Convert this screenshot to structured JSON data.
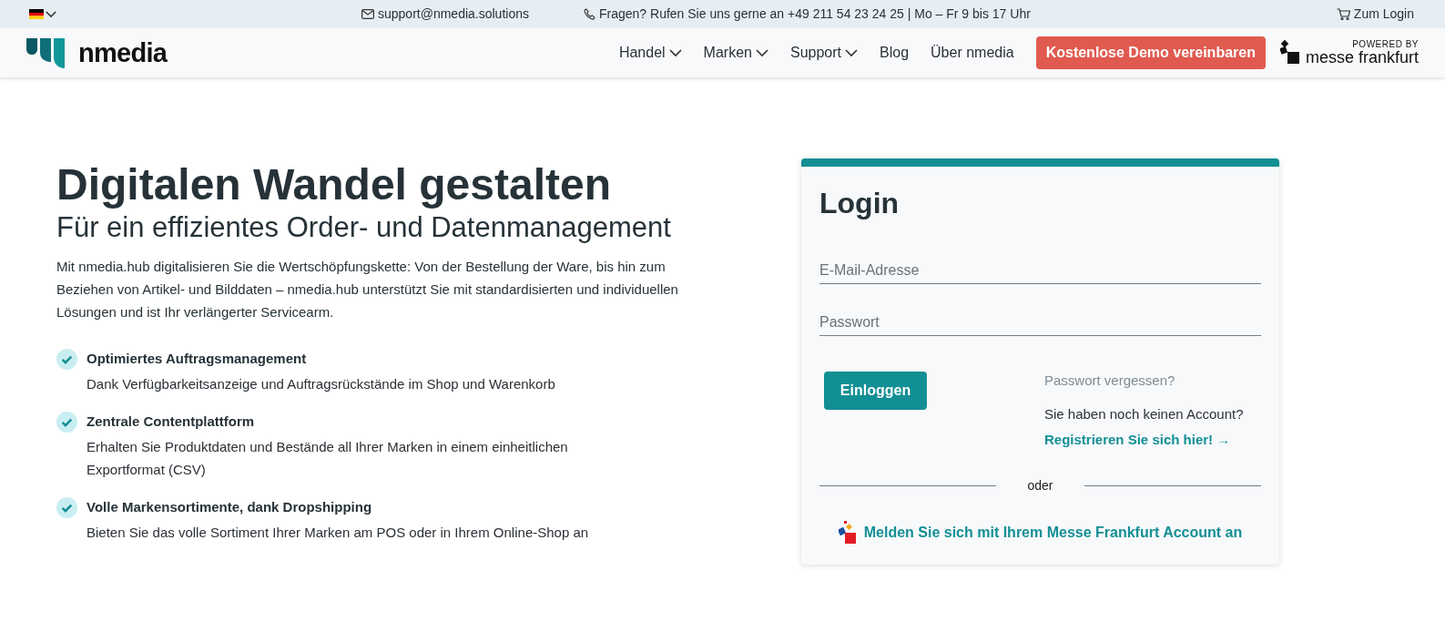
{
  "top_bar": {
    "language_menu": {
      "expanded": false
    },
    "email": "support@nmedia.solutions",
    "phone_info": "Fragen? Rufen Sie uns gerne an +49 211 54 23 24 25 | Mo – Fr 9 bis 17 Uhr",
    "login_link": "Zum Login"
  },
  "header": {
    "logo_text": "nmedia",
    "nav": [
      {
        "label": "Handel",
        "has_dropdown": true
      },
      {
        "label": "Marken",
        "has_dropdown": true
      },
      {
        "label": "Support",
        "has_dropdown": true
      },
      {
        "label": "Blog",
        "has_dropdown": false
      },
      {
        "label": "Über nmedia",
        "has_dropdown": false
      }
    ],
    "cta_button": "Kostenlose Demo vereinbaren",
    "powered_by": "POWERED BY",
    "partner_name": "messe frankfurt"
  },
  "hero": {
    "title": "Digitalen Wandel gestalten",
    "subtitle": "Für ein effizientes Order- und Datenmanagement",
    "intro": "Mit nmedia.hub digitalisieren Sie die Wertschöpfungskette: Von der Bestellung der Ware, bis hin zum Beziehen von Artikel- und Bilddaten – nmedia.hub unterstützt Sie mit standardisierten und individuellen Lösungen und ist Ihr verlängerter Servicearm.",
    "features": [
      {
        "title": "Optimiertes Auftragsmanagement",
        "text": "Dank Verfügbarkeitsanzeige und Auftragsrückstände im Shop und Warenkorb"
      },
      {
        "title": "Zentrale Contentplattform",
        "text": "Erhalten Sie Produktdaten und Bestände all Ihrer Marken in einem einheitlichen Exportformat (CSV)"
      },
      {
        "title": "Volle Markensortimente, dank Dropshipping",
        "text": "Bieten Sie das volle Sortiment Ihrer Marken am POS oder in Ihrem Online-Shop an"
      }
    ]
  },
  "login": {
    "title": "Login",
    "email_field": {
      "placeholder": "E-Mail-Adresse"
    },
    "password_field": {
      "placeholder": "Passwort"
    },
    "submit_button": "Einloggen",
    "forgot_link": "Passwort vergessen?",
    "no_account_text": "Sie haben noch keinen Account?",
    "register_link": "Registrieren Sie sich hier! →",
    "divider_text": "oder",
    "sso_link": "Melden Sie sich mit Ihrem Messe Frankfurt Account an"
  }
}
